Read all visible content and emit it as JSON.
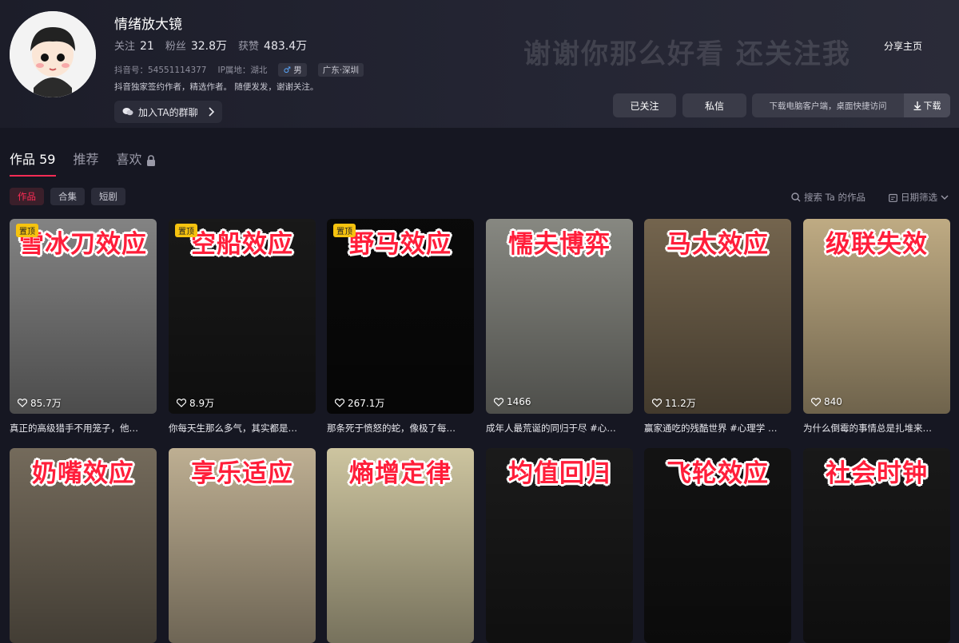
{
  "profile": {
    "username": "情绪放大镜",
    "stats": [
      {
        "label": "关注",
        "value": "21"
      },
      {
        "label": "粉丝",
        "value": "32.8万"
      },
      {
        "label": "获赞",
        "value": "483.4万"
      }
    ],
    "douyin_id": "抖音号：54551114377",
    "ip_location": "IP属地：湖北",
    "gender_tag": "男",
    "region_tag": "广东·深圳",
    "bio": "抖音独家签约作者，精选作者。 随便发发，谢谢关注。",
    "group_chat_label": "加入TA的群聊",
    "banner_text": "谢谢你那么好看 还关注我"
  },
  "actions": {
    "share": "分享主页",
    "followed": "已关注",
    "message": "私信",
    "download_text": "下载电脑客户端，桌面快捷访问",
    "download_button": "下载"
  },
  "tabs": [
    {
      "label": "作品",
      "count": "59"
    },
    {
      "label": "推荐"
    },
    {
      "label": "喜欢"
    }
  ],
  "chips": [
    "作品",
    "合集",
    "短剧"
  ],
  "search_placeholder": "搜索 Ta 的作品",
  "date_filter": "日期筛选",
  "pin_label": "置顶",
  "videos": [
    {
      "title": "雪冰刀效应",
      "likes": "85.7万",
      "caption": "真正的高级猎手不用笼子，他…",
      "pinned": true,
      "bg": "#8a8a8a"
    },
    {
      "title": "空船效应",
      "likes": "8.9万",
      "caption": "你每天生那么多气，其实都是…",
      "pinned": true,
      "bg": "#1a1a1a"
    },
    {
      "title": "野马效应",
      "likes": "267.1万",
      "caption": "那条死于愤怒的蛇，像极了每…",
      "pinned": true,
      "bg": "#0a0a0a"
    },
    {
      "title": "懦夫博弈",
      "likes": "1466",
      "caption": "成年人最荒诞的同归于尽 #心…",
      "pinned": false,
      "bg": "#8e8f88"
    },
    {
      "title": "马太效应",
      "likes": "11.2万",
      "caption": "赢家通吃的残酷世界 #心理学 …",
      "pinned": false,
      "bg": "#7a6a52"
    },
    {
      "title": "级联失效",
      "likes": "840",
      "caption": "为什么倒霉的事情总是扎堆来…",
      "pinned": false,
      "bg": "#c9b48a"
    },
    {
      "title": "奶嘴效应",
      "likes": "",
      "caption": "",
      "pinned": false,
      "bg": "#7a7060"
    },
    {
      "title": "享乐适应",
      "likes": "",
      "caption": "",
      "pinned": false,
      "bg": "#c8b89a"
    },
    {
      "title": "熵增定律",
      "likes": "",
      "caption": "",
      "pinned": false,
      "bg": "#d8cfa8"
    },
    {
      "title": "均值回归",
      "likes": "",
      "caption": "",
      "pinned": false,
      "bg": "#1c1c1c"
    },
    {
      "title": "飞轮效应",
      "likes": "",
      "caption": "",
      "pinned": false,
      "bg": "#141414"
    },
    {
      "title": "社会时钟",
      "likes": "",
      "caption": "",
      "pinned": false,
      "bg": "#1a1a1a"
    }
  ]
}
